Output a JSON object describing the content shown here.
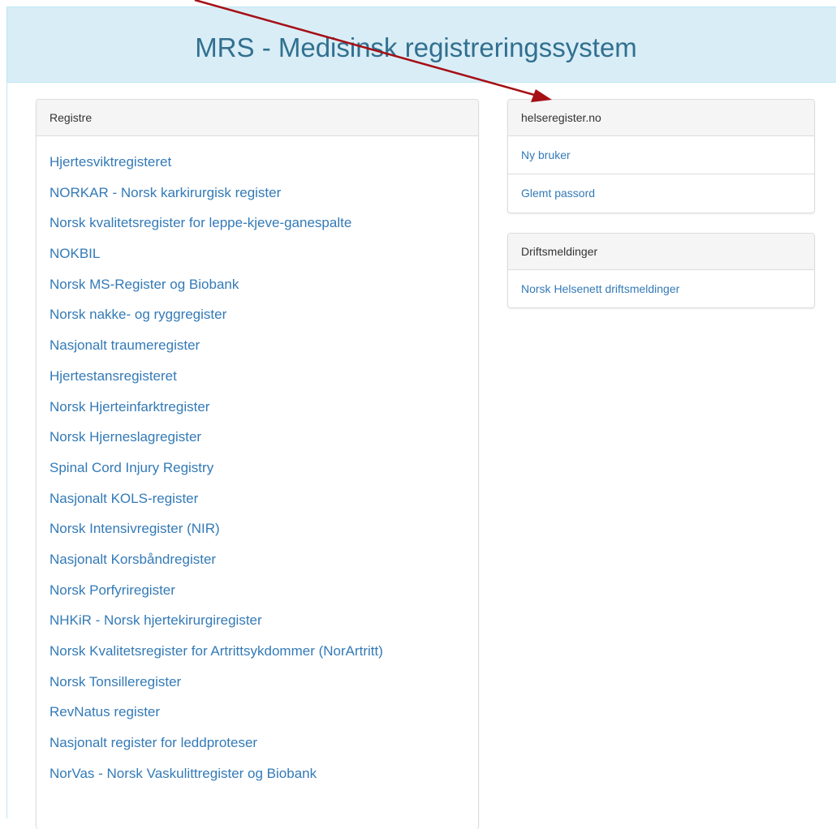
{
  "header": {
    "title": "MRS - Medisinsk registreringssystem"
  },
  "registries": {
    "heading": "Registre",
    "items": [
      "Hjertesviktregisteret",
      "NORKAR - Norsk karkirurgisk register",
      "Norsk kvalitetsregister for leppe-kjeve-ganespalte",
      "NOKBIL",
      "Norsk MS-Register og Biobank",
      "Norsk nakke- og ryggregister",
      "Nasjonalt traumeregister",
      "Hjertestansregisteret",
      "Norsk Hjerteinfarktregister",
      "Norsk Hjerneslagregister",
      "Spinal Cord Injury Registry",
      "Nasjonalt KOLS-register",
      "Norsk Intensivregister (NIR)",
      "Nasjonalt Korsbåndregister",
      "Norsk Porfyriregister",
      "NHKiR - Norsk hjertekirurgiregister",
      "Norsk Kvalitetsregister for Artrittsykdommer (NorArtritt)",
      "Norsk Tonsilleregister",
      "RevNatus register",
      "Nasjonalt register for leddproteser",
      "NorVas - Norsk Vaskulittregister og Biobank"
    ]
  },
  "helseregister": {
    "heading": "helseregister.no",
    "new_user": "Ny bruker",
    "forgot_password": "Glemt passord"
  },
  "operations": {
    "heading": "Driftsmeldinger",
    "link": "Norsk Helsenett driftsmeldinger"
  },
  "colors": {
    "link": "#337ab7",
    "header_bg": "#d9edf7",
    "header_text": "#31708f",
    "annotation_arrow": "#a50f15"
  }
}
